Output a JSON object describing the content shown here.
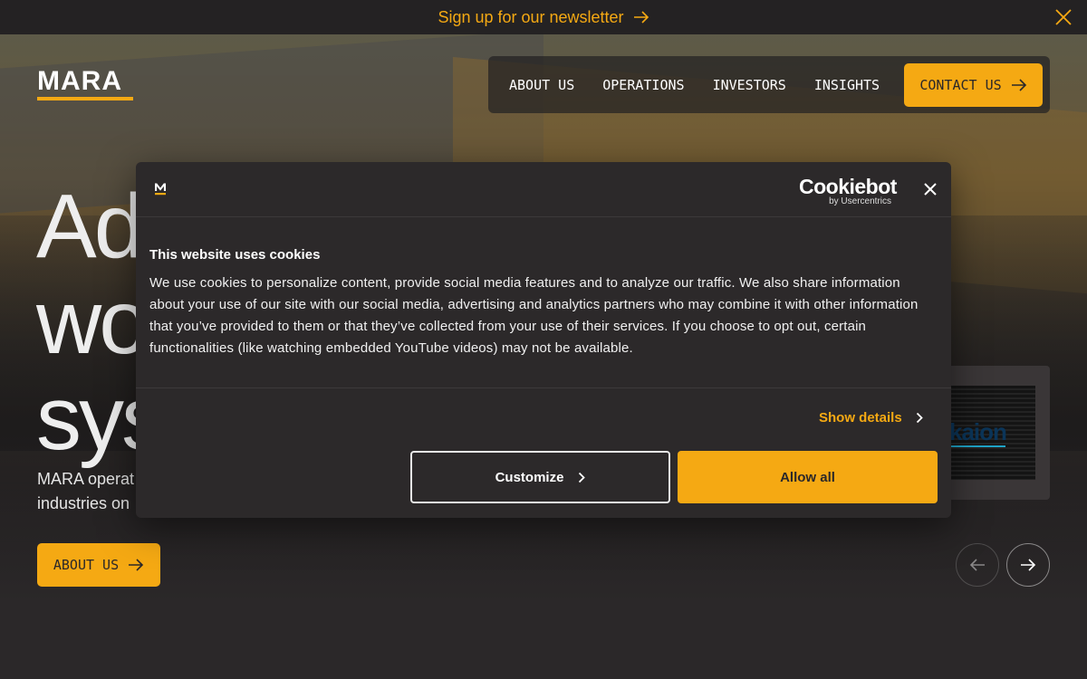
{
  "topbar": {
    "newsletter_label": "Sign up for our newsletter"
  },
  "logo": {
    "text": "MARA"
  },
  "nav": {
    "items": [
      "ABOUT US",
      "OPERATIONS",
      "INVESTORS",
      "INSIGHTS"
    ],
    "contact_label": "CONTACT US"
  },
  "hero": {
    "headline_lines": [
      "Ad",
      "wo",
      "sys"
    ],
    "subtext_lines": [
      "MARA operat",
      "industries on"
    ],
    "about_button_label": "ABOUT US",
    "card_brand": "kaion"
  },
  "cookie_dialog": {
    "brand_main": "Cookiebot",
    "brand_sub": "by Usercentrics",
    "title": "This website uses cookies",
    "body": "We use cookies to personalize content, provide social media features and to analyze our traffic. We also share information about your use of our site with our social media, advertising and analytics partners who may combine it with other information that you’ve provided to them or that they’ve collected from your use of their services. If you choose to opt out, certain functionalities (like watching embedded YouTube videos) may not be available.",
    "show_details_label": "Show details",
    "customize_label": "Customize",
    "allow_all_label": "Allow all"
  },
  "colors": {
    "accent": "#f5a913",
    "background": "#2b2829",
    "dialog": "#2c292a"
  },
  "icons": [
    "arrow-right-icon",
    "close-icon",
    "chevron-right-icon",
    "arrow-left-icon",
    "mara-mark-icon"
  ]
}
